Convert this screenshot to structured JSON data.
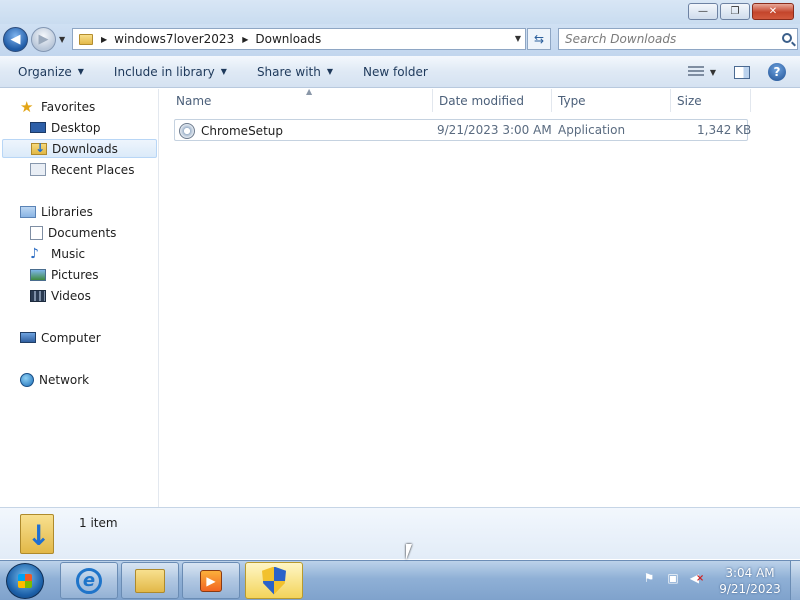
{
  "window": {
    "minimize_glyph": "—",
    "maximize_glyph": "❐",
    "close_glyph": "✕"
  },
  "address": {
    "crumbs": [
      "windows7lover2023",
      "Downloads"
    ],
    "search_placeholder": "Search Downloads"
  },
  "toolbar": {
    "organize": "Organize",
    "include_in_library": "Include in library",
    "share_with": "Share with",
    "new_folder": "New folder"
  },
  "nav": {
    "favorites": "Favorites",
    "desktop": "Desktop",
    "downloads": "Downloads",
    "recent_places": "Recent Places",
    "libraries": "Libraries",
    "documents": "Documents",
    "music": "Music",
    "pictures": "Pictures",
    "videos": "Videos",
    "computer": "Computer",
    "network": "Network"
  },
  "columns": {
    "name": "Name",
    "date_modified": "Date modified",
    "type": "Type",
    "size": "Size"
  },
  "files": [
    {
      "name": "ChromeSetup",
      "date_modified": "9/21/2023 3:00 AM",
      "type": "Application",
      "size": "1,342 KB"
    }
  ],
  "details": {
    "item_count": "1 item"
  },
  "taskbar": {
    "time": "3:04 AM",
    "date": "9/21/2023"
  },
  "colors": {
    "accent": "#1f5ba6",
    "selection": "#dbeaf9",
    "taskbar": "#8fb0d6"
  }
}
